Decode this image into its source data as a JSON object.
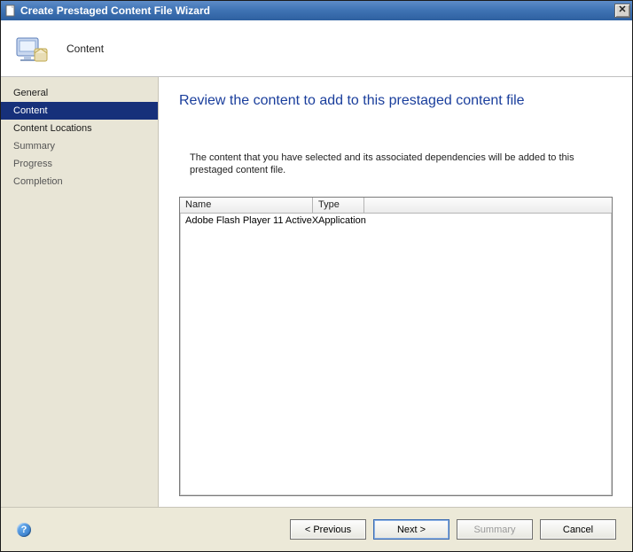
{
  "window": {
    "title": "Create Prestaged Content File Wizard"
  },
  "header": {
    "label": "Content"
  },
  "sidebar": {
    "items": [
      {
        "label": "General",
        "selected": false,
        "sub": false
      },
      {
        "label": "Content",
        "selected": true,
        "sub": false
      },
      {
        "label": "Content Locations",
        "selected": false,
        "sub": false
      },
      {
        "label": "Summary",
        "selected": false,
        "sub": true
      },
      {
        "label": "Progress",
        "selected": false,
        "sub": true
      },
      {
        "label": "Completion",
        "selected": false,
        "sub": true
      }
    ]
  },
  "main": {
    "heading": "Review the content to add to this prestaged content file",
    "description": "The content that you have selected and its associated dependencies will be added to this prestaged content file.",
    "columns": {
      "name": "Name",
      "type": "Type",
      "extra": ""
    },
    "rows": [
      {
        "name": "Adobe Flash Player 11 ActiveX",
        "type": "Application"
      }
    ]
  },
  "footer": {
    "previous": "< Previous",
    "next": "Next >",
    "summary": "Summary",
    "cancel": "Cancel",
    "help_glyph": "?"
  }
}
